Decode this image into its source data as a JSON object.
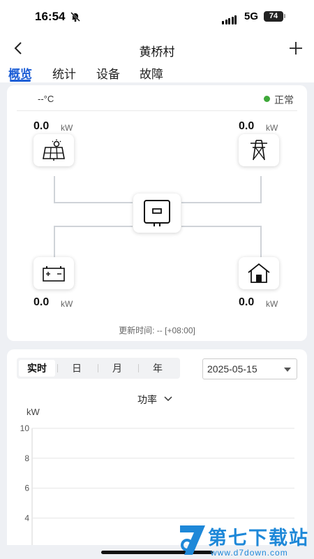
{
  "status_bar": {
    "time": "16:54",
    "network": "5G",
    "battery": "74"
  },
  "nav": {
    "title": "黄桥村"
  },
  "tabs": [
    {
      "label": "概览",
      "active": true
    },
    {
      "label": "统计",
      "active": false
    },
    {
      "label": "设备",
      "active": false
    },
    {
      "label": "故障",
      "active": false
    }
  ],
  "overview": {
    "temperature": "--°C",
    "status": "正常",
    "status_color": "#3fa83a",
    "pv": {
      "value": "0.0",
      "unit": "kW",
      "icon": "solar-panel-icon"
    },
    "grid": {
      "value": "0.0",
      "unit": "kW",
      "icon": "power-tower-icon"
    },
    "inverter": {
      "icon": "inverter-icon"
    },
    "battery": {
      "value": "0.0",
      "unit": "kW",
      "icon": "battery-icon"
    },
    "load": {
      "value": "0.0",
      "unit": "kW",
      "icon": "home-icon"
    },
    "update_time": "更新时间:  -- [+08:00]"
  },
  "chart_panel": {
    "periods": [
      "实时",
      "日",
      "月",
      "年"
    ],
    "active_period": "实时",
    "date": "2025-05-15",
    "metric": "功率"
  },
  "chart_data": {
    "type": "line",
    "title": "",
    "ylabel": "kW",
    "xlabel": "",
    "yticks": [
      10,
      8,
      6,
      4
    ],
    "ylim": [
      0,
      10
    ],
    "series": []
  },
  "watermark": {
    "text": "第七下载站",
    "url": "www.d7down.com"
  },
  "accent_color": "#1e5fd6"
}
